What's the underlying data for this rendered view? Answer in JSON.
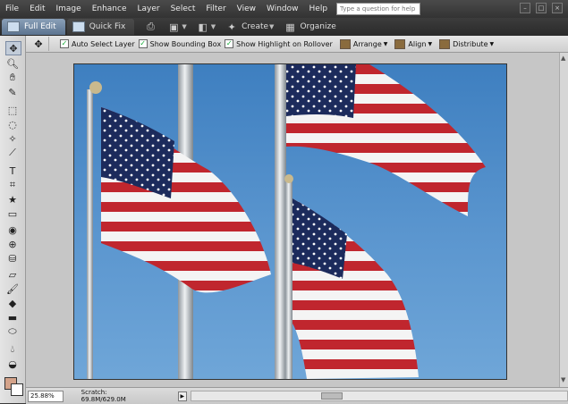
{
  "menubar": {
    "items": [
      "File",
      "Edit",
      "Image",
      "Enhance",
      "Layer",
      "Select",
      "Filter",
      "View",
      "Window",
      "Help"
    ],
    "help_placeholder": "Type a question for help"
  },
  "mode_tabs": {
    "full_edit": "Full Edit",
    "quick_fix": "Quick Fix"
  },
  "top_toolbar": {
    "create_label": "Create",
    "organize_label": "Organize"
  },
  "options_bar": {
    "auto_select_layer": "Auto Select Layer",
    "show_bounding_box": "Show Bounding Box",
    "show_highlight": "Show Highlight on Rollover",
    "arrange": "Arrange",
    "align": "Align",
    "distribute": "Distribute"
  },
  "status": {
    "zoom": "25.88%",
    "scratch": "Scratch: 69.8M/629.0M"
  },
  "colors": {
    "foreground": "#d4a38a",
    "background": "#ffffff",
    "sky": "#4f8cc8",
    "flag_red": "#c0262e",
    "flag_blue": "#1c2b5c"
  }
}
